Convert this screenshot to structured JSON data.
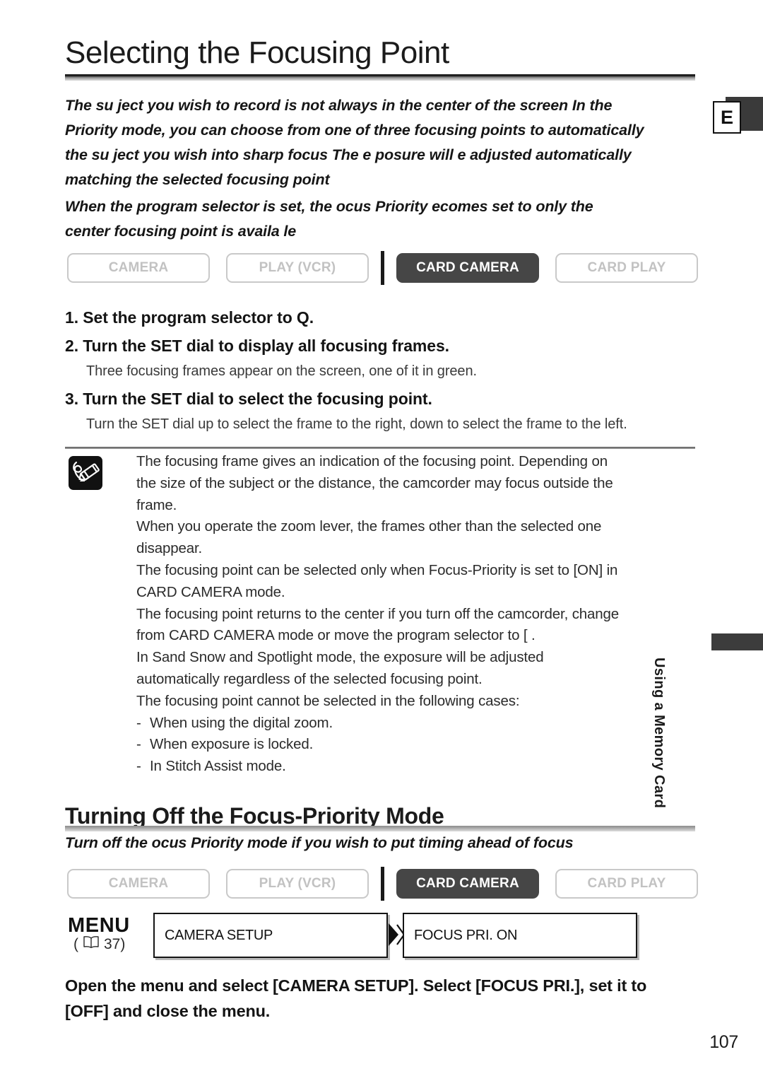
{
  "document": {
    "page_number": "107",
    "index_tab_letter": "E",
    "side_tab_label": "Using a Memory Card"
  },
  "section1": {
    "title": "Selecting the Focusing Point",
    "intro_paragraph_1_line_1": "The su  ject you wish to record is not always in the center of the screen  In the",
    "intro_paragraph_1_line_2": "Priority mode, you can choose from one of three focusing points to automatically",
    "intro_paragraph_1_line_3": "the su  ject you wish into sharp focus  The e  posure will   e adjusted automatically",
    "intro_paragraph_1_line_4": "matching the selected focusing point",
    "intro_paragraph_2_line_1": "When the program selector is set, the   ocus Priority   ecomes set to        only the",
    "intro_paragraph_2_line_2": "center focusing point is availa  le",
    "modes": [
      {
        "label": "CAMERA",
        "active": false
      },
      {
        "label": "PLAY (VCR)",
        "active": false
      },
      {
        "label": "CARD CAMERA",
        "active": true
      },
      {
        "label": "CARD PLAY",
        "active": false
      }
    ],
    "steps": [
      {
        "head": "1. Set the program selector to Q."
      },
      {
        "head": "2. Turn the SET dial to display all focusing frames.",
        "body": "Three focusing frames appear on the screen, one of it in green."
      },
      {
        "head": "3. Turn the SET dial to select the focusing point.",
        "body": "Turn the SET dial up to select the frame to the right, down to select the frame to the left."
      }
    ],
    "notes_icon": "memo-pencil-icon",
    "notes": [
      "The focusing frame gives an indication of the focusing point. Depending on",
      "the size of the subject or the distance, the camcorder may focus outside the",
      "frame.",
      "When you operate the zoom lever, the frames other than the selected one",
      "disappear.",
      "The focusing point can be selected only when Focus-Priority is set to [ON] in",
      "CARD CAMERA mode.",
      "The focusing point returns to the center if you turn off the camcorder, change",
      "from CARD CAMERA mode or move the program selector to [ .",
      "In Sand    Snow and Spotlight mode, the exposure will be adjusted",
      "automatically regardless of the selected focusing point.",
      "The focusing point cannot be selected in the following cases:"
    ],
    "notes_bullets": [
      "When using the digital zoom.",
      "When exposure is locked.",
      "In Stitch Assist mode."
    ],
    "bullet_dash": "-"
  },
  "section2": {
    "title": "Turning Off the Focus-Priority Mode",
    "intro": "Turn off the   ocus Priority mode if you wish to put timing ahead of focus",
    "modes": [
      {
        "label": "CAMERA",
        "active": false
      },
      {
        "label": "PLAY (VCR)",
        "active": false
      },
      {
        "label": "CARD CAMERA",
        "active": true
      },
      {
        "label": "CARD PLAY",
        "active": false
      }
    ],
    "menu": {
      "label": "MENU",
      "reference_open": "(",
      "reference_page": "37)",
      "box1": "CAMERA SETUP",
      "box2": "FOCUS PRI.  ON",
      "arrow_icon": "right-triangle-arrow-icon",
      "book_icon": "book-icon"
    },
    "closing_line_1": "Open the menu and select [CAMERA SETUP]. Select [FOCUS PRI.], set it to",
    "closing_line_2": "[OFF] and close the menu."
  },
  "colors": {
    "active_mode_bg": "#464646",
    "inactive_mode_border": "#c9c9c9",
    "inactive_mode_text": "#c2c2c2",
    "ink": "#141414"
  }
}
